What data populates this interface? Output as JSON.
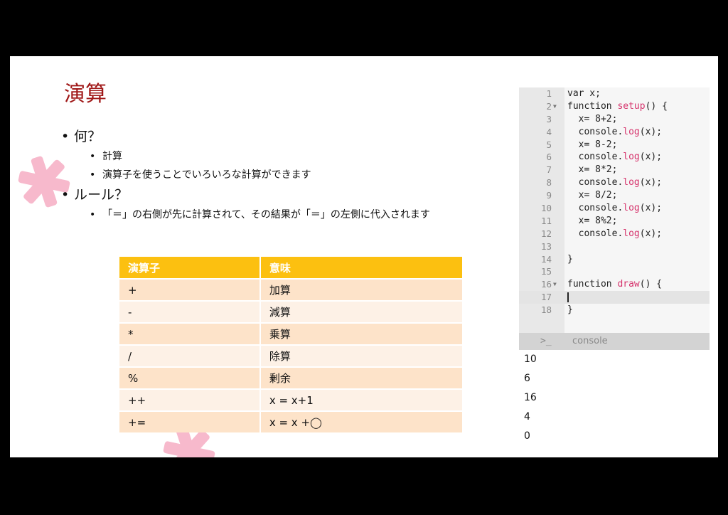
{
  "title": "演算",
  "bullets": {
    "b1": "何？",
    "b1_sub1": "計算",
    "b1_sub2": "演算子を使うことでいろいろな計算ができます",
    "b2": "ルール？",
    "b2_sub1": "「＝」の右側が先に計算されて、その結果が「＝」の左側に代入されます"
  },
  "table": {
    "headers": [
      "演算子",
      "意味"
    ],
    "rows": [
      [
        "+",
        "加算"
      ],
      [
        "-",
        "減算"
      ],
      [
        "*",
        "乗算"
      ],
      [
        "/",
        "除算"
      ],
      [
        "%",
        "剰余"
      ],
      [
        "++",
        "x = x+1"
      ],
      [
        "+=",
        "x = x +◯"
      ]
    ]
  },
  "editor": {
    "lines": [
      {
        "n": "1",
        "t": "var x;"
      },
      {
        "n": "2",
        "t": "function setup() {"
      },
      {
        "n": "3",
        "t": "  x= 8+2;"
      },
      {
        "n": "4",
        "t": "  console.log(x);"
      },
      {
        "n": "5",
        "t": "  x= 8-2;"
      },
      {
        "n": "6",
        "t": "  console.log(x);"
      },
      {
        "n": "7",
        "t": "  x= 8*2;"
      },
      {
        "n": "8",
        "t": "  console.log(x);"
      },
      {
        "n": "9",
        "t": "  x= 8/2;"
      },
      {
        "n": "10",
        "t": "  console.log(x);"
      },
      {
        "n": "11",
        "t": "  x= 8%2;"
      },
      {
        "n": "12",
        "t": "  console.log(x);"
      },
      {
        "n": "13",
        "t": ""
      },
      {
        "n": "14",
        "t": "}"
      },
      {
        "n": "15",
        "t": ""
      },
      {
        "n": "16",
        "t": "function draw() {"
      },
      {
        "n": "17",
        "t": ""
      },
      {
        "n": "18",
        "t": "}"
      }
    ],
    "fold_icon": "triangle-down-icon"
  },
  "console": {
    "prompt": ">_",
    "label": "console",
    "output": [
      "10",
      "6",
      "16",
      "4",
      "0"
    ]
  },
  "colors": {
    "title": "#a01818",
    "table_header": "#fcc010",
    "row_odd": "#fde3c9",
    "row_even": "#fdf1e6",
    "decoration": "#f7b9cc",
    "function_name": "#d6336c"
  }
}
